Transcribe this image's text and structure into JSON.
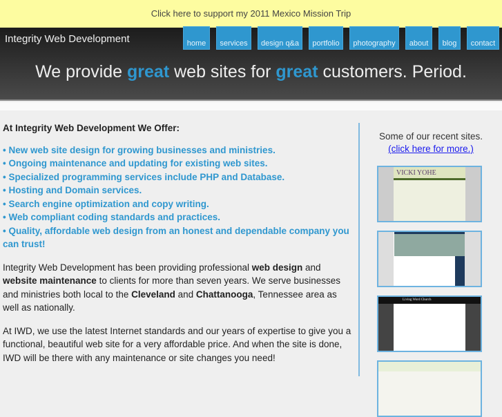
{
  "banner": {
    "text": "Click here to support my 2011 Mexico Mission Trip"
  },
  "header": {
    "logo": "Integrity Web Development",
    "nav": [
      "home",
      "services",
      "design q&a",
      "portfolio",
      "photography",
      "about",
      "blog",
      "contact"
    ],
    "tagline": {
      "p1": "We provide ",
      "h1": "great",
      "p2": " web sites for ",
      "h2": "great",
      "p3": " customers. Period."
    }
  },
  "main": {
    "heading": "At Integrity Web Development We Offer:",
    "offers": [
      "New web site design for growing businesses and ministries.",
      "Ongoing maintenance and updating for existing web sites.",
      "Specialized programming services include PHP and Database.",
      "Hosting and Domain services.",
      "Search engine optimization and copy writing.",
      "Web compliant coding standards and practices.",
      "Quality, affordable web design from an honest and dependable company you can trust!"
    ],
    "para1": {
      "a": "Integrity Web Development has been providing professional ",
      "b1": "web design",
      "c": " and ",
      "b2": "website maintenance",
      "d": " to clients for more than seven years. We serve businesses and ministries both local to the ",
      "b3": "Cleveland",
      "e": " and ",
      "b4": "Chattanooga",
      "f": ", Tennessee area as well as nationally."
    },
    "para2": "At IWD, we use the latest Internet standards and our years of expertise to give you a functional, beautiful web site for a very affordable price. And when the site is done, IWD will be there with any maintenance or site changes you need!"
  },
  "sidebar": {
    "title": "Some of our recent sites.",
    "link": "(click here for more.)",
    "thumbs": [
      {
        "name": "VICKI YOHE"
      },
      {
        "name": ""
      },
      {
        "name": "Living Word Church"
      },
      {
        "name": ""
      }
    ]
  },
  "colors": {
    "accent": "#2f97cf",
    "banner": "#fdfca0"
  }
}
